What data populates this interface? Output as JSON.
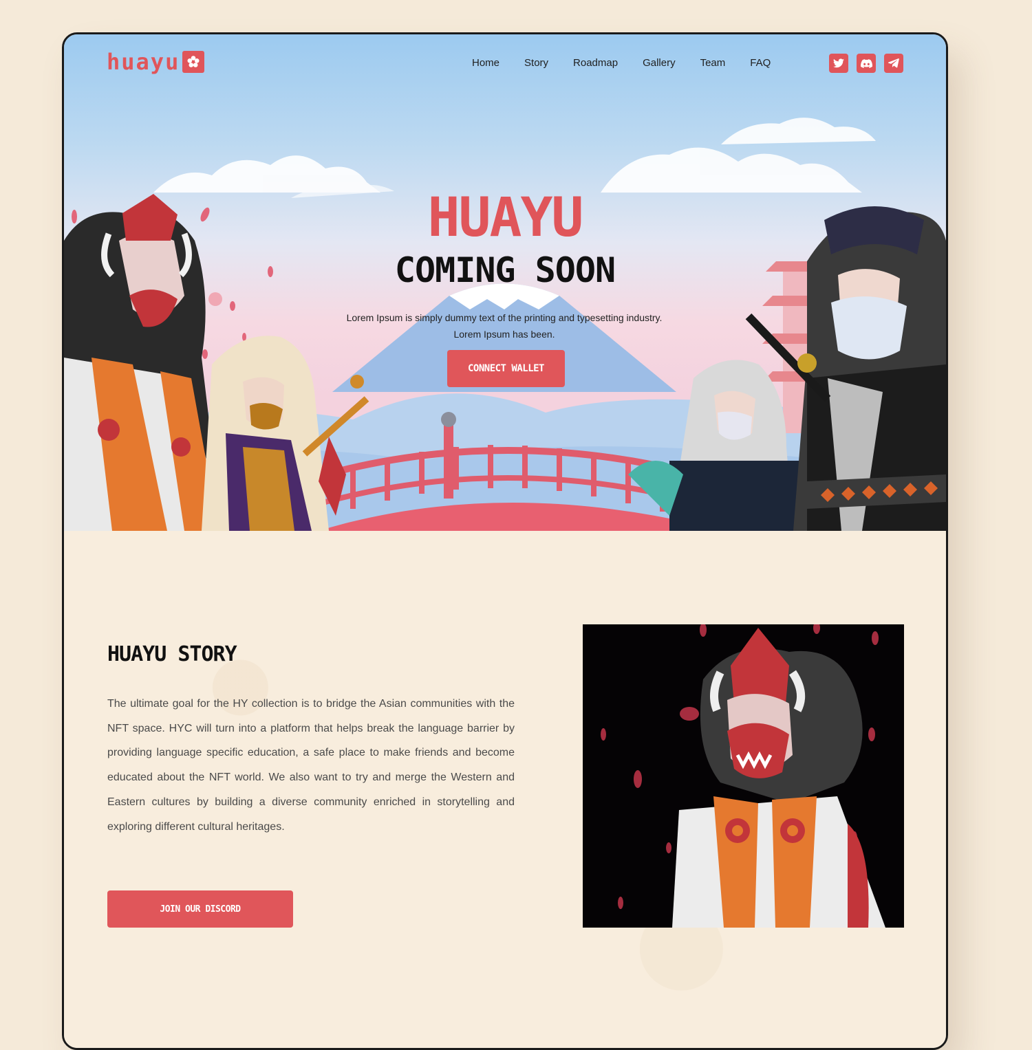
{
  "brand": {
    "logo_text": "huayu",
    "accent": "#e0555a"
  },
  "nav": {
    "items": [
      "Home",
      "Story",
      "Roadmap",
      "Gallery",
      "Team",
      "FAQ"
    ]
  },
  "socials": [
    "twitter-icon",
    "discord-icon",
    "telegram-icon"
  ],
  "hero": {
    "title": "HUAYU",
    "subtitle": "COMING SOON",
    "description": "Lorem Ipsum is simply dummy text of the printing and typesetting industry. Lorem Ipsum has been.",
    "cta_label": "CONNECT WALLET"
  },
  "story": {
    "title": "HUAYU STORY",
    "body": "The ultimate goal for the HY collection is to bridge the Asian communities with the NFT space. HYC will turn into a platform that helps break the language barrier by providing language specific education, a safe place to make friends and become educated about the NFT world. We also want to try and merge the Western and Eastern cultures by building a diverse community enriched in storytelling and exploring different cultural heritages.",
    "cta_label": "JOIN OUR DISCORD"
  },
  "colors": {
    "accent": "#e0555a",
    "page_bg": "#f5ead9",
    "text": "#4a4a4a"
  }
}
